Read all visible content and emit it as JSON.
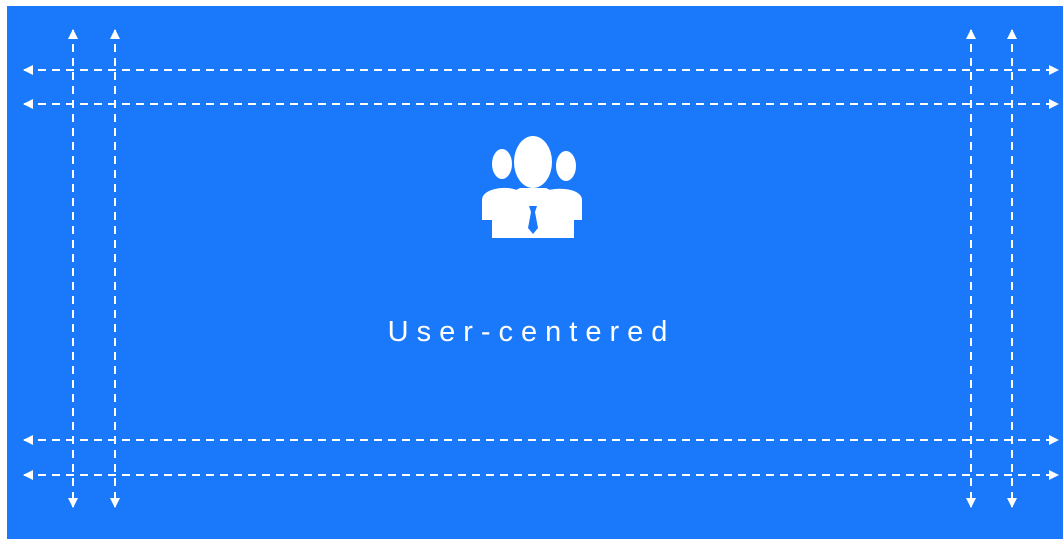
{
  "caption": "User-centered",
  "icons": {
    "center": "users-group-icon",
    "guides": "dashed-arrow-guide-icon"
  },
  "colors": {
    "background": "#1a79fb",
    "foreground": "#ffffff",
    "page": "#ffffff"
  }
}
